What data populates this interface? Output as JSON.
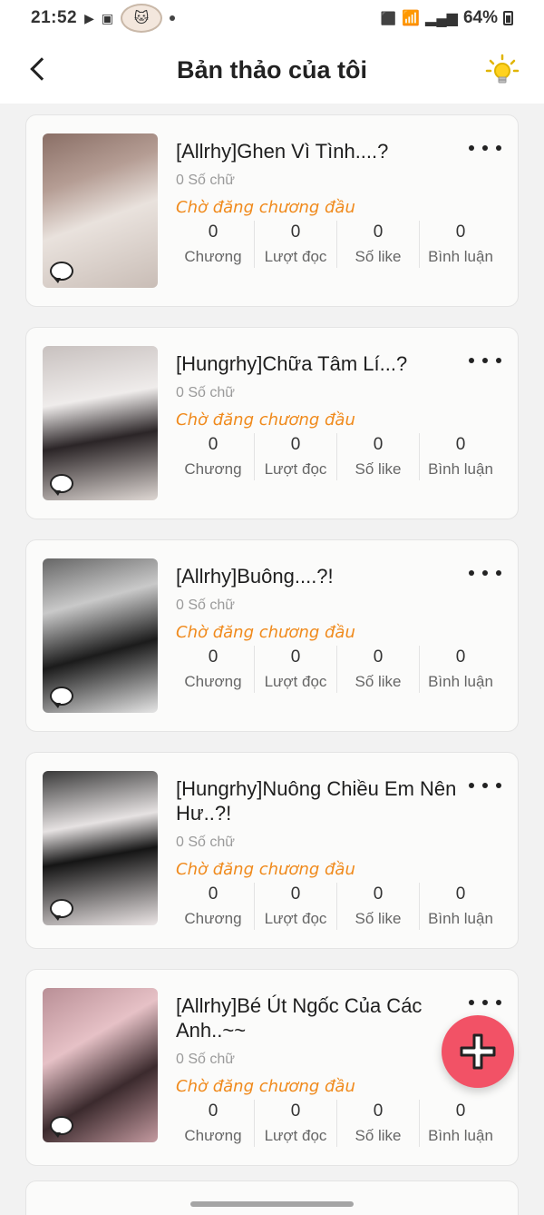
{
  "status_bar": {
    "time": "21:52",
    "battery": "64%"
  },
  "header": {
    "title": "Bản thảo của tôi"
  },
  "stat_labels": {
    "chapters": "Chương",
    "reads": "Lượt đọc",
    "likes": "Số like",
    "comments": "Bình luận"
  },
  "drafts": [
    {
      "title": "[Allrhy]Ghen Vì Tình....?",
      "word_count": "0 Số chữ",
      "status": "Chờ đăng chương đầu",
      "chapters": "0",
      "reads": "0",
      "likes": "0",
      "comments": "0"
    },
    {
      "title": "[Hungrhy]Chữa Tâm Lí...?",
      "word_count": "0 Số chữ",
      "status": "Chờ đăng chương đầu",
      "chapters": "0",
      "reads": "0",
      "likes": "0",
      "comments": "0"
    },
    {
      "title": "[Allrhy]Buông....?!",
      "word_count": "0 Số chữ",
      "status": "Chờ đăng chương đầu",
      "chapters": "0",
      "reads": "0",
      "likes": "0",
      "comments": "0"
    },
    {
      "title": "[Hungrhy]Nuông Chiều Em Nên Hư..?!",
      "word_count": "0 Số chữ",
      "status": "Chờ đăng chương đầu",
      "chapters": "0",
      "reads": "0",
      "likes": "0",
      "comments": "0"
    },
    {
      "title": "[Allrhy]Bé Út Ngốc Của Các Anh..~~",
      "word_count": "0 Số chữ",
      "status": "Chờ đăng chương đầu",
      "chapters": "0",
      "reads": "0",
      "likes": "0",
      "comments": "0"
    }
  ],
  "colors": {
    "accent_orange": "#f08a1c",
    "fab_pink": "#f25266",
    "background": "#f2f2f2"
  },
  "icons": {
    "back": "chevron-left-icon",
    "tip": "lightbulb-icon",
    "more": "more-horizontal-icon",
    "add": "plus-icon",
    "comment": "comment-bubble-icon"
  }
}
